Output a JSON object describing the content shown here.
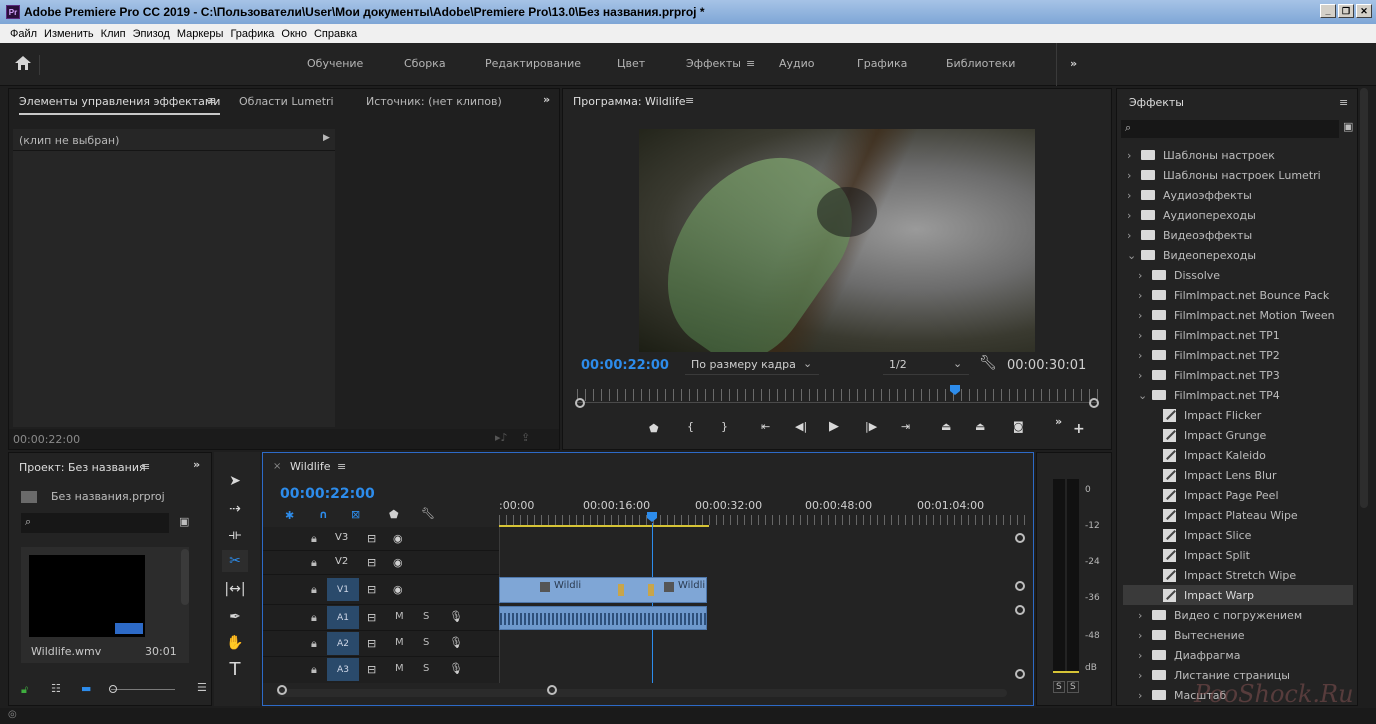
{
  "window": {
    "title": "Adobe Premiere Pro CC 2019 - C:\\Пользователи\\User\\Мои документы\\Adobe\\Premiere Pro\\13.0\\Без названия.prproj *",
    "app_icon": "Pr"
  },
  "menu": [
    "Файл",
    "Изменить",
    "Клип",
    "Эпизод",
    "Маркеры",
    "Графика",
    "Окно",
    "Справка"
  ],
  "workspaces": {
    "items": [
      "Обучение",
      "Сборка",
      "Редактирование",
      "Цвет",
      "Эффекты",
      "Аудио",
      "Графика",
      "Библиотеки"
    ],
    "active": "Эффекты"
  },
  "effect_controls": {
    "tabs": [
      "Элементы управления эффектами",
      "Области Lumetri",
      "Источник: (нет клипов)"
    ],
    "no_clip": "(клип не выбран)",
    "timecode": "00:00:22:00"
  },
  "program": {
    "title": "Программа: Wildlife",
    "timecode": "00:00:22:00",
    "fit": "По размеру кадра",
    "resolution": "1/2",
    "duration": "00:00:30:01"
  },
  "project": {
    "title": "Проект: Без названия",
    "file": "Без названия.prproj",
    "clip_name": "Wildlife.wmv",
    "clip_duration": "30:01"
  },
  "timeline": {
    "tab": "Wildlife",
    "timecode": "00:00:22:00",
    "ruler": [
      ":00:00",
      "00:00:16:00",
      "00:00:32:00",
      "00:00:48:00",
      "00:01:04:00"
    ],
    "tracks": [
      "V3",
      "V2",
      "V1",
      "A1",
      "A2",
      "A3"
    ],
    "mute": "M",
    "solo": "S",
    "clip_label": "Wildli"
  },
  "meters": {
    "scale": [
      "0",
      "-12",
      "-24",
      "-36",
      "-48",
      "dB"
    ],
    "solo": [
      "S",
      "S"
    ]
  },
  "effects": {
    "title": "Эффекты",
    "items": [
      {
        "label": "Шаблоны настроек",
        "indent": 0,
        "type": "preset",
        "open": false
      },
      {
        "label": "Шаблоны настроек Lumetri",
        "indent": 0,
        "type": "preset",
        "open": false
      },
      {
        "label": "Аудиоэффекты",
        "indent": 0,
        "type": "folder",
        "open": false
      },
      {
        "label": "Аудиопереходы",
        "indent": 0,
        "type": "folder",
        "open": false
      },
      {
        "label": "Видеоэффекты",
        "indent": 0,
        "type": "folder",
        "open": false
      },
      {
        "label": "Видеопереходы",
        "indent": 0,
        "type": "folder",
        "open": true
      },
      {
        "label": "Dissolve",
        "indent": 1,
        "type": "folder",
        "open": false
      },
      {
        "label": "FilmImpact.net Bounce Pack",
        "indent": 1,
        "type": "folder",
        "open": false
      },
      {
        "label": "FilmImpact.net Motion Tween",
        "indent": 1,
        "type": "folder",
        "open": false
      },
      {
        "label": "FilmImpact.net TP1",
        "indent": 1,
        "type": "folder",
        "open": false
      },
      {
        "label": "FilmImpact.net TP2",
        "indent": 1,
        "type": "folder",
        "open": false
      },
      {
        "label": "FilmImpact.net TP3",
        "indent": 1,
        "type": "folder",
        "open": false
      },
      {
        "label": "FilmImpact.net TP4",
        "indent": 1,
        "type": "folder",
        "open": true
      },
      {
        "label": "Impact Flicker",
        "indent": 2,
        "type": "fx"
      },
      {
        "label": "Impact Grunge",
        "indent": 2,
        "type": "fx"
      },
      {
        "label": "Impact Kaleido",
        "indent": 2,
        "type": "fx"
      },
      {
        "label": "Impact Lens Blur",
        "indent": 2,
        "type": "fx"
      },
      {
        "label": "Impact Page Peel",
        "indent": 2,
        "type": "fx"
      },
      {
        "label": "Impact Plateau Wipe",
        "indent": 2,
        "type": "fx"
      },
      {
        "label": "Impact Slice",
        "indent": 2,
        "type": "fx"
      },
      {
        "label": "Impact Split",
        "indent": 2,
        "type": "fx"
      },
      {
        "label": "Impact Stretch Wipe",
        "indent": 2,
        "type": "fx"
      },
      {
        "label": "Impact Warp",
        "indent": 2,
        "type": "fx",
        "selected": true
      },
      {
        "label": "Видео с погружением",
        "indent": 1,
        "type": "folder",
        "open": false
      },
      {
        "label": "Вытеснение",
        "indent": 1,
        "type": "folder",
        "open": false
      },
      {
        "label": "Диафрагма",
        "indent": 1,
        "type": "folder",
        "open": false
      },
      {
        "label": "Листание страницы",
        "indent": 1,
        "type": "folder",
        "open": false
      },
      {
        "label": "Масштаб",
        "indent": 1,
        "type": "folder",
        "open": false
      }
    ]
  },
  "watermark": "PooShock.Ru"
}
